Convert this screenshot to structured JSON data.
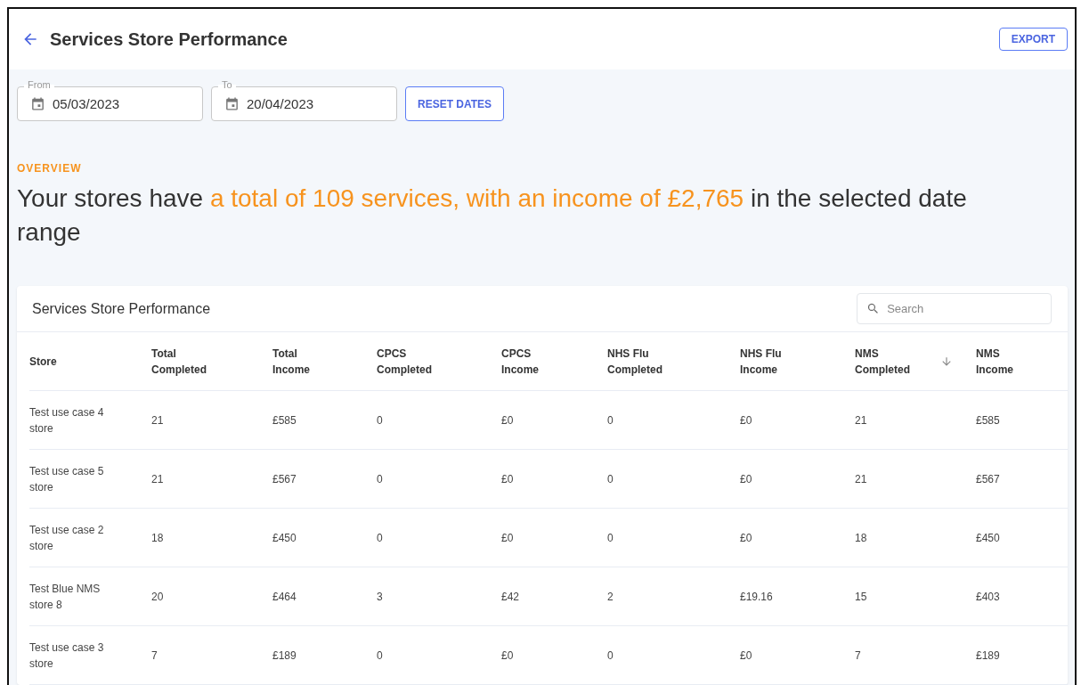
{
  "header": {
    "title": "Services Store Performance",
    "export_label": "EXPORT"
  },
  "filters": {
    "from": {
      "label": "From",
      "value": "05/03/2023"
    },
    "to": {
      "label": "To",
      "value": "20/04/2023"
    },
    "reset_label": "RESET DATES"
  },
  "overview": {
    "label": "OVERVIEW",
    "headline": [
      {
        "text": "Your stores have ",
        "highlight": false
      },
      {
        "text": "a total of 109 services, with an income of £2,765",
        "highlight": true
      },
      {
        "text": " in the selected date range",
        "highlight": false
      }
    ]
  },
  "table": {
    "title": "Services Store Performance",
    "search": {
      "placeholder": "Search"
    },
    "columns": [
      {
        "label": "Store",
        "sorted": false
      },
      {
        "label": "Total Completed",
        "sorted": false
      },
      {
        "label": "Total Income",
        "sorted": false
      },
      {
        "label": "CPCS Completed",
        "sorted": false
      },
      {
        "label": "CPCS Income",
        "sorted": false
      },
      {
        "label": "NHS Flu Completed",
        "sorted": false
      },
      {
        "label": "NHS Flu Income",
        "sorted": false
      },
      {
        "label": "NMS Completed",
        "sorted": true
      },
      {
        "label": "NMS Income",
        "sorted": false
      }
    ],
    "rows": [
      [
        "Test use case 4 store",
        "21",
        "£585",
        "0",
        "£0",
        "0",
        "£0",
        "21",
        "£585"
      ],
      [
        "Test use case 5 store",
        "21",
        "£567",
        "0",
        "£0",
        "0",
        "£0",
        "21",
        "£567"
      ],
      [
        "Test use case 2 store",
        "18",
        "£450",
        "0",
        "£0",
        "0",
        "£0",
        "18",
        "£450"
      ],
      [
        "Test Blue NMS store 8",
        "20",
        "£464",
        "3",
        "£42",
        "2",
        "£19.16",
        "15",
        "£403"
      ],
      [
        "Test use case 3 store",
        "7",
        "£189",
        "0",
        "£0",
        "0",
        "£0",
        "7",
        "£189"
      ]
    ]
  }
}
